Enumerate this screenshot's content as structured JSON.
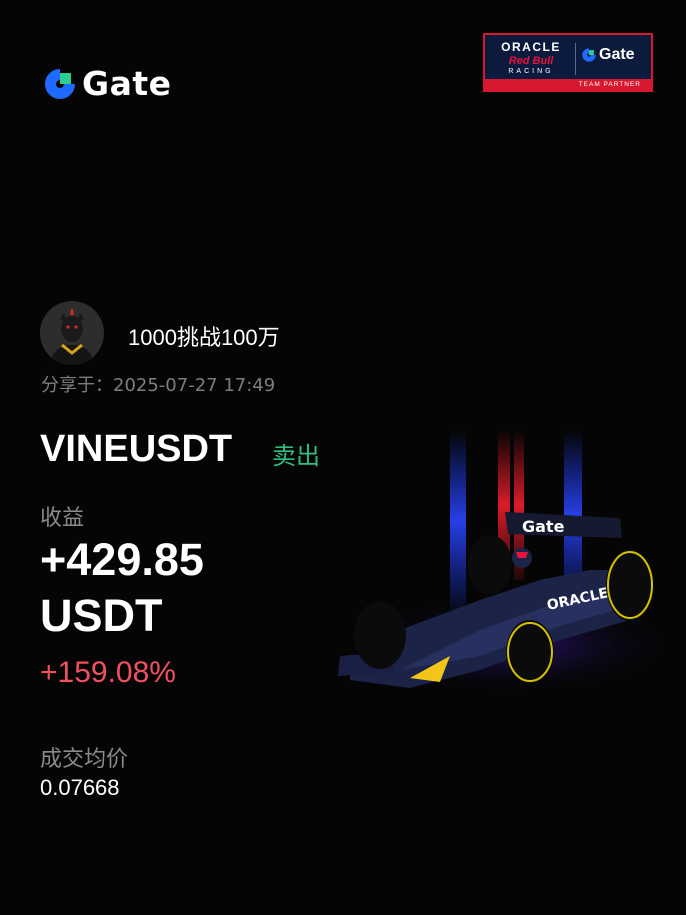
{
  "brand": {
    "name": "Gate",
    "logo_icon": "gate-logo-icon",
    "accent_blue": "#1f6bff",
    "accent_green": "#2bd08c"
  },
  "partner_badge": {
    "oracle": "ORACLE",
    "redbull": "Red Bull",
    "racing": "RACING",
    "gate": "Gate",
    "caption": "TEAM PARTNER"
  },
  "user": {
    "name": "1000挑战100万",
    "avatar_icon": "avatar-image",
    "shared_at": "分享于：2025-07-27 17:49"
  },
  "trade": {
    "symbol": "VINEUSDT",
    "side": "卖出",
    "side_color": "#2cbf80",
    "profit_label": "收益",
    "profit_value": "+429.85",
    "profit_currency": "USDT",
    "profit_percent": "+159.08%",
    "profit_percent_color": "#f0505f",
    "avg_price_label": "成交均价",
    "avg_price_value": "0.07668"
  }
}
